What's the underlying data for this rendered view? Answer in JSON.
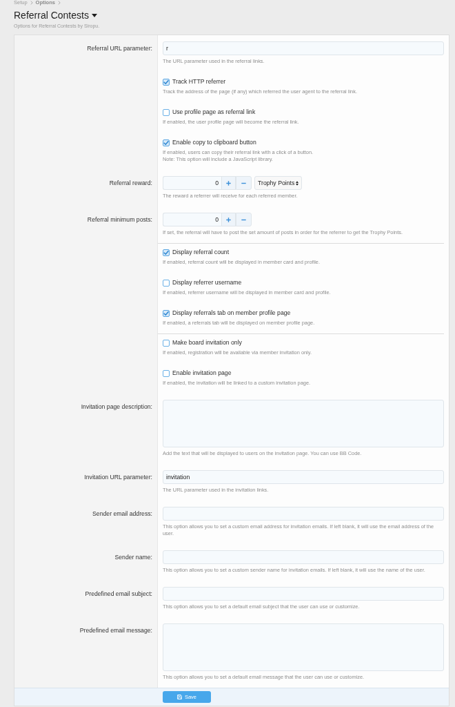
{
  "breadcrumb": [
    {
      "label": "Setup",
      "current": false
    },
    {
      "label": "Options",
      "current": true
    }
  ],
  "header": {
    "title": "Referral Contests",
    "description": "Options for Referral Contests by Siropu."
  },
  "groups": [
    {
      "options": [
        {
          "kind": "text",
          "label": "Referral URL parameter:",
          "value": "r",
          "hint": "The URL parameter used in the referral links."
        },
        {
          "kind": "checkbox",
          "text": "Track HTTP referrer",
          "checked": true,
          "hint": "Track the address of the page (if any) which referred the user agent to the referral link."
        },
        {
          "kind": "checkbox",
          "text": "Use profile page as referral link",
          "checked": false,
          "hint": "If enabled, the user profile page will become the referral link."
        },
        {
          "kind": "checkbox",
          "text": "Enable copy to clipboard button",
          "checked": true,
          "hint": "If enabled, users can copy their referral link with a click of a button.\nNote: This option will include a JavaScript library."
        },
        {
          "kind": "number",
          "label": "Referral reward:",
          "value": "0",
          "unit": "Trophy Points",
          "hint": "The reward a referrer will receive for each referred member."
        },
        {
          "kind": "number",
          "label": "Referral minimum posts:",
          "value": "0",
          "hint": "If set, the referral will have to post the set amount of posts in order for the referrer to get the Trophy Points."
        }
      ]
    },
    {
      "options": [
        {
          "kind": "checkbox",
          "text": "Display referral count",
          "checked": true,
          "hint": "If enabled, referral count will be displayed in member card and profile."
        },
        {
          "kind": "checkbox",
          "text": "Display referrer username",
          "checked": false,
          "hint": "If enabled, referrer username will be displayed in member card and profile."
        },
        {
          "kind": "checkbox",
          "text": "Display referrals tab on member profile page",
          "checked": true,
          "hint": "If enabled, a referrals tab will be displayed on member profile page."
        }
      ]
    },
    {
      "options": [
        {
          "kind": "checkbox",
          "text": "Make board invitation only",
          "checked": false,
          "hint": "If enabled, registration will be available via member invitation only."
        },
        {
          "kind": "checkbox",
          "text": "Enable invitation page",
          "checked": false,
          "hint": "If enabled, the invitation will be linked to a custom invitation page."
        },
        {
          "kind": "textarea",
          "label": "Invitation page description:",
          "hint": "Add the text that will be displayed to users on the invitation page. You can use BB Code."
        },
        {
          "kind": "text",
          "label": "Invitation URL parameter:",
          "value": "invitation",
          "hint": "The URL parameter used in the invitation links."
        },
        {
          "kind": "text",
          "label": "Sender email address:",
          "hint": "This option allows you to set a custom email address for invitation emails. If left blank, it will use the email address of the user."
        },
        {
          "kind": "text",
          "label": "Sender name:",
          "hint": "This option allows you to set a custom sender name for invitation emails. If left blank, it will use the name of the user."
        },
        {
          "kind": "text",
          "label": "Predefined email subject:",
          "hint": "This option allows you to set a default email subject that the user can use or customize."
        },
        {
          "kind": "textarea",
          "label": "Predefined email message:",
          "hint": "This option allows you to set a default email message that the user can use or customize."
        }
      ]
    }
  ],
  "footer": {
    "save_button": "Save"
  }
}
